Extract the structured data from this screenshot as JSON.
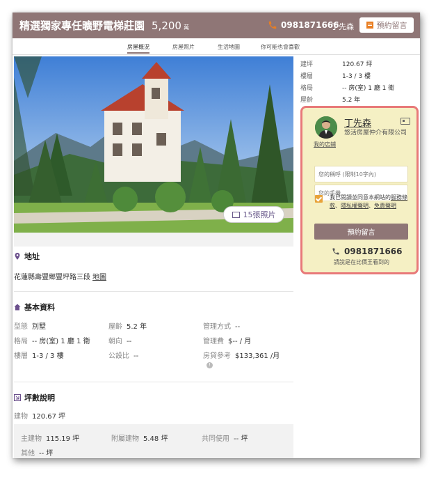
{
  "header": {
    "title": "精選獨家專任曠野電梯莊園",
    "price": "5,200",
    "price_unit": "萬",
    "phone": "0981871666",
    "agent": "丁先森",
    "message_button": "預約留言"
  },
  "tabs": [
    {
      "label": "房屋概況",
      "active": true
    },
    {
      "label": "房屋照片",
      "active": false
    },
    {
      "label": "生活地圖",
      "active": false
    },
    {
      "label": "你可能也會喜歡",
      "active": false
    }
  ],
  "photo": {
    "count_label": "15張照片"
  },
  "right_specs": [
    {
      "label": "建坪",
      "value": "120.67 坪"
    },
    {
      "label": "樓層",
      "value": "1-3 / 3 樓"
    },
    {
      "label": "格局",
      "value": "-- 房(室) 1 廳 1 衛"
    },
    {
      "label": "屋齡",
      "value": "5.2 年"
    }
  ],
  "address": {
    "title": "地址",
    "text": "花蓮縣壽豐鄉豐坪路三段",
    "map_link": "地圖"
  },
  "basic": {
    "title": "基本資料",
    "items": [
      {
        "label": "型態",
        "value": "別墅"
      },
      {
        "label": "屋齡",
        "value": "5.2 年"
      },
      {
        "label": "管理方式",
        "value": "--"
      },
      {
        "label": "格局",
        "value": "-- 房(室) 1 廳 1 衛"
      },
      {
        "label": "朝向",
        "value": "--"
      },
      {
        "label": "管理費",
        "value": "$-- / 月"
      },
      {
        "label": "樓層",
        "value": "1-3 / 3 樓"
      },
      {
        "label": "公設比",
        "value": "--"
      },
      {
        "label": "房貸參考",
        "value": "$133,361 /月"
      }
    ]
  },
  "area": {
    "title": "坪數說明",
    "building": {
      "label": "建物",
      "value": "120.67 坪"
    },
    "details": [
      {
        "label": "主建物",
        "value": "115.19 坪"
      },
      {
        "label": "附屬建物",
        "value": "5.48 坪"
      },
      {
        "label": "共同使用",
        "value": "-- 坪"
      },
      {
        "label": "其他",
        "value": "-- 坪"
      }
    ]
  },
  "agent_box": {
    "name": "丁先森",
    "company": "悠活房屋仲介有限公司",
    "store_link": "我的店鋪",
    "name_placeholder": "您的稱呼 (限制10字內)",
    "phone_placeholder": "您的手機",
    "agree_prefix": "我已閱讀並同意本網站的",
    "agree_link1": "服務條款",
    "agree_sep": "、",
    "agree_link2": "隱私權聲明",
    "agree_link3": "免責聲明",
    "submit": "預約留言",
    "phone": "0981871666",
    "note": "請說是在比價王看到的"
  },
  "colors": {
    "header_bg": "#8f7676",
    "accent_orange": "#e97e22",
    "agent_box_bg": "#f5f0c4",
    "agent_box_border": "#e87979"
  }
}
